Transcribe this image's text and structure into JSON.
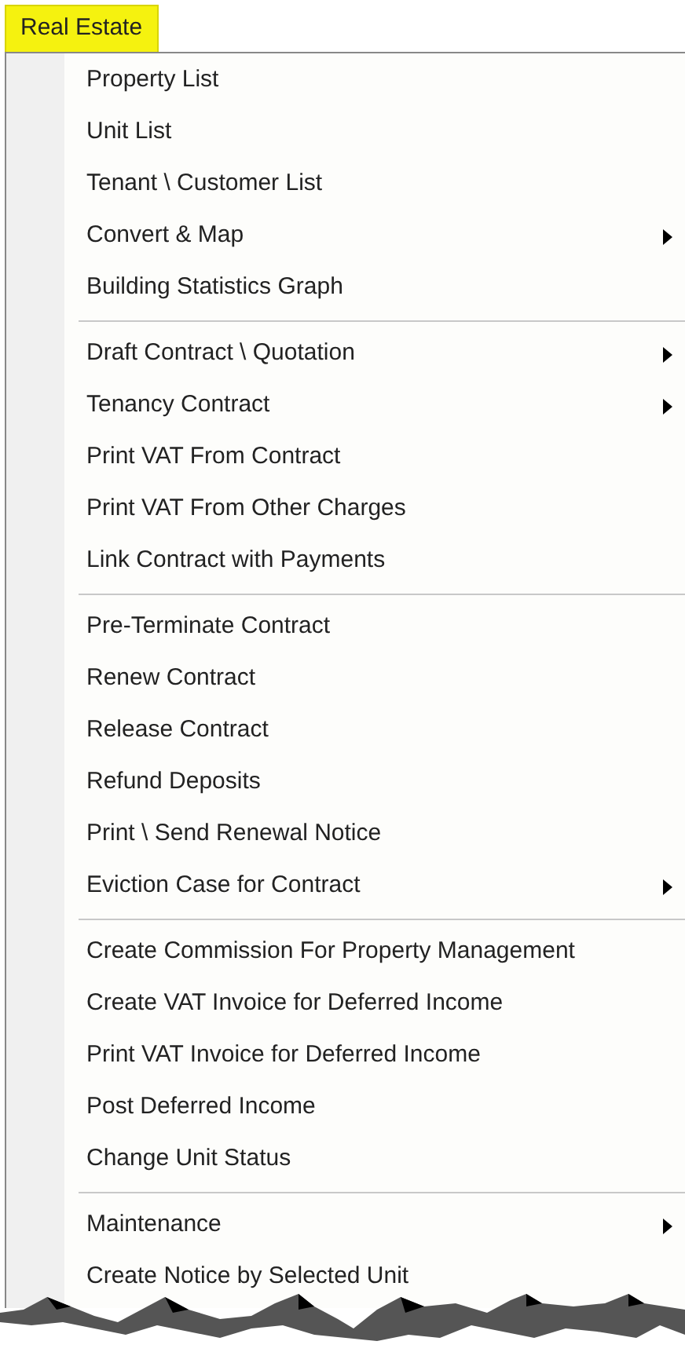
{
  "menu_title": "Real Estate",
  "groups": [
    {
      "items": [
        {
          "label": "Property List",
          "submenu": false
        },
        {
          "label": "Unit List",
          "submenu": false
        },
        {
          "label": "Tenant \\ Customer List",
          "submenu": false
        },
        {
          "label": "Convert & Map",
          "submenu": true
        },
        {
          "label": "Building Statistics Graph",
          "submenu": false
        }
      ]
    },
    {
      "items": [
        {
          "label": "Draft Contract \\ Quotation",
          "submenu": true
        },
        {
          "label": "Tenancy Contract",
          "submenu": true
        },
        {
          "label": "Print VAT From Contract",
          "submenu": false
        },
        {
          "label": "Print VAT From Other Charges",
          "submenu": false
        },
        {
          "label": "Link Contract with Payments",
          "submenu": false
        }
      ]
    },
    {
      "items": [
        {
          "label": "Pre-Terminate Contract",
          "submenu": false
        },
        {
          "label": "Renew Contract",
          "submenu": false
        },
        {
          "label": "Release Contract",
          "submenu": false
        },
        {
          "label": "Refund Deposits",
          "submenu": false
        },
        {
          "label": "Print \\ Send Renewal Notice",
          "submenu": false
        },
        {
          "label": "Eviction Case for Contract",
          "submenu": true
        }
      ]
    },
    {
      "items": [
        {
          "label": "Create Commission For Property Management",
          "submenu": false
        },
        {
          "label": "Create VAT Invoice for Deferred Income",
          "submenu": false
        },
        {
          "label": "Print VAT Invoice for Deferred Income",
          "submenu": false
        },
        {
          "label": "Post Deferred Income",
          "submenu": false
        },
        {
          "label": "Change Unit Status",
          "submenu": false
        }
      ]
    },
    {
      "items": [
        {
          "label": "Maintenance",
          "submenu": true
        },
        {
          "label": "Create Notice by Selected Unit",
          "submenu": false
        }
      ]
    }
  ]
}
